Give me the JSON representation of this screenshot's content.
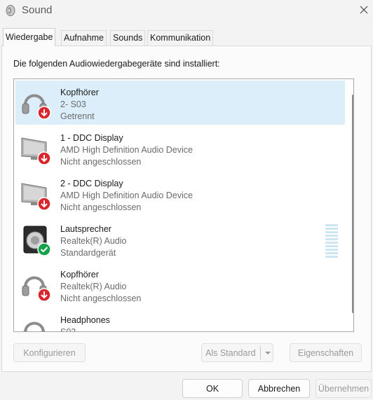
{
  "window": {
    "title": "Sound",
    "close_glyph": "✕"
  },
  "tabs": [
    {
      "label": "Wiedergabe",
      "active": true
    },
    {
      "label": "Aufnahme"
    },
    {
      "label": "Sounds"
    },
    {
      "label": "Kommunikation"
    }
  ],
  "instructions": "Die folgenden Audiowiedergabegeräte sind installiert:",
  "devices": [
    {
      "icon": "headphones-icon",
      "status_icon": "red-down-arrow-icon",
      "name": "Kopfhörer",
      "line2": "2- S03",
      "line3": "Getrennt",
      "selected": true
    },
    {
      "icon": "monitor-icon",
      "status_icon": "red-down-arrow-icon",
      "name": "1 - DDC Display",
      "line2": "AMD High Definition Audio Device",
      "line3": "Nicht angeschlossen"
    },
    {
      "icon": "monitor-icon",
      "status_icon": "red-down-arrow-icon",
      "name": "2 - DDC Display",
      "line2": "AMD High Definition Audio Device",
      "line3": "Nicht angeschlossen"
    },
    {
      "icon": "speaker-icon",
      "status_icon": "green-check-icon",
      "name": "Lautsprecher",
      "line2": "Realtek(R) Audio",
      "line3": "Standardgerät",
      "level_meter": true
    },
    {
      "icon": "headphones-icon",
      "status_icon": "red-down-arrow-icon",
      "name": "Kopfhörer",
      "line2": "Realtek(R) Audio",
      "line3": "Nicht angeschlossen"
    },
    {
      "icon": "headphones-icon",
      "name": "Headphones",
      "line2": "S03",
      "line3": ""
    }
  ],
  "buttons": {
    "configure": "Konfigurieren",
    "set_default": "Als Standard",
    "properties": "Eigenschaften",
    "ok": "OK",
    "cancel": "Abbrechen",
    "apply": "Übernehmen"
  },
  "colors": {
    "selection": "#dbeefa",
    "error_red": "#d9262b",
    "ok_green": "#15a24a"
  }
}
